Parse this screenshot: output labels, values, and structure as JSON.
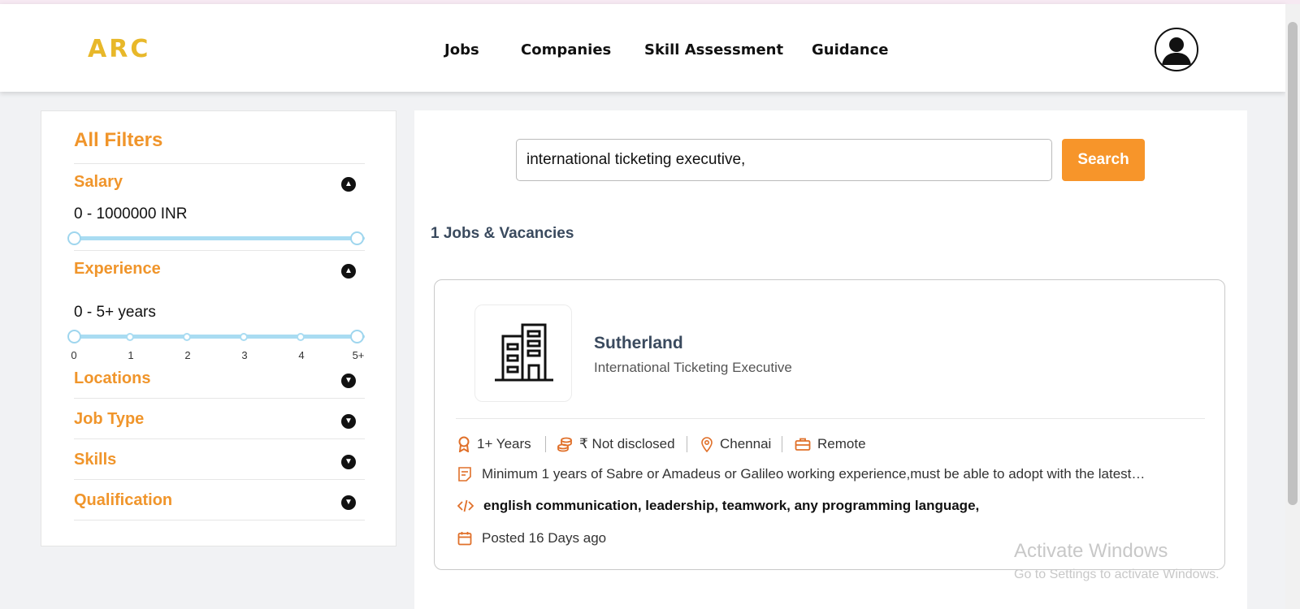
{
  "header": {
    "logo": "ARC",
    "nav": [
      {
        "label": "Jobs"
      },
      {
        "label": "Companies"
      },
      {
        "label": "Skill Assessment"
      },
      {
        "label": "Guidance"
      }
    ]
  },
  "filters": {
    "title": "All Filters",
    "salary": {
      "label": "Salary",
      "range_text": "0 - 1000000 INR"
    },
    "experience": {
      "label": "Experience",
      "range_text": "0 - 5+ years",
      "ticks": [
        "0",
        "1",
        "2",
        "3",
        "4",
        "5+"
      ]
    },
    "sections": [
      {
        "label": "Locations"
      },
      {
        "label": "Job Type"
      },
      {
        "label": "Skills"
      },
      {
        "label": "Qualification"
      }
    ],
    "icons": {
      "expanded": "chevron-up-icon",
      "collapsed": "chevron-down-icon"
    }
  },
  "search": {
    "query": "international ticketing executive,",
    "button_label": "Search"
  },
  "results": {
    "count_text": "1 Jobs & Vacancies",
    "jobs": [
      {
        "company": "Sutherland",
        "title": "International Ticketing Executive",
        "experience": "1+ Years",
        "salary": "₹ Not disclosed",
        "location": "Chennai",
        "job_type": "Remote",
        "description": "Minimum 1 years of Sabre or Amadeus or Galileo working experience,must be able to adopt with the latest…",
        "skills": "english communication, leadership, teamwork, any programming language,",
        "posted": "Posted 16 Days ago"
      }
    ]
  },
  "watermark": {
    "line1": "Activate Windows",
    "line2": "Go to Settings to activate Windows."
  },
  "colors": {
    "accent": "#f7952a",
    "filter_label": "#f0952b",
    "logo": "#e8b82a",
    "slider": "#a9dcf2",
    "heading": "#3a4a5e"
  }
}
